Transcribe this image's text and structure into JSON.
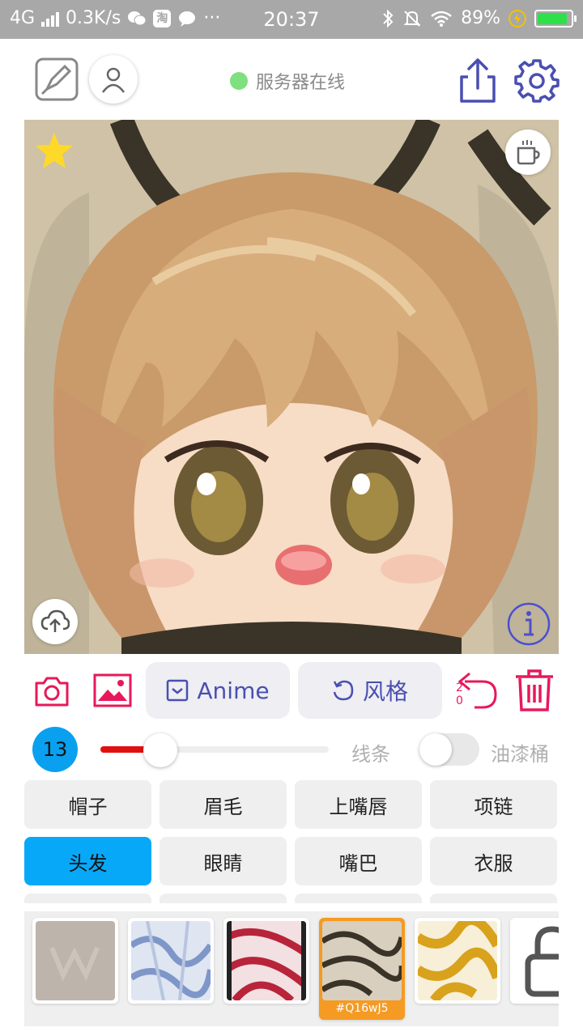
{
  "status_bar": {
    "network": "4G",
    "speed": "0.3K/s",
    "time": "20:37",
    "battery": "89%",
    "icons": [
      "signal-icon",
      "wechat-icon",
      "taobao-icon",
      "message-icon",
      "more-icon",
      "bluetooth-icon",
      "mute-icon",
      "wifi-icon",
      "charging-icon",
      "battery-icon"
    ],
    "taobao_glyph": "淘",
    "more_glyph": "···"
  },
  "toolbar": {
    "server_status": "服务器在线",
    "server_status_color": "#7ee07e",
    "accent_color": "#4a4fb0"
  },
  "actions": {
    "model_label": "Anime",
    "style_label": "风格",
    "undo_count": "20"
  },
  "brush": {
    "size": "13",
    "size_fraction": 0.2,
    "line_label": "线条",
    "bucket_label": "油漆桶",
    "bucket_enabled": false
  },
  "categories": {
    "row1": [
      "帽子",
      "眉毛",
      "上嘴唇",
      "项链"
    ],
    "row2": [
      "头发",
      "眼睛",
      "嘴巴",
      "衣服"
    ],
    "active": "头发",
    "active_color": "#08a8f8"
  },
  "styles": {
    "selected_code": "#Q16wJ5",
    "selected_color": "#f59a23"
  }
}
